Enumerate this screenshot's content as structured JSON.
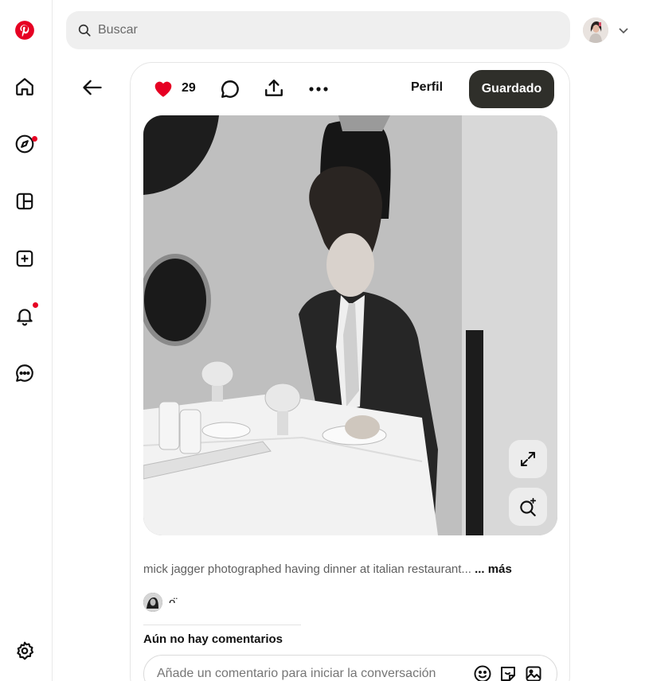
{
  "brand": {
    "logo_icon": "pinterest-logo-icon",
    "color": "#e60023"
  },
  "sidebar": {
    "items": [
      {
        "name": "home",
        "icon": "home-icon"
      },
      {
        "name": "explore",
        "icon": "compass-icon",
        "has_dot": true
      },
      {
        "name": "boards",
        "icon": "board-icon"
      },
      {
        "name": "create",
        "icon": "plus-square-icon"
      },
      {
        "name": "notifications",
        "icon": "bell-icon",
        "has_dot": true
      },
      {
        "name": "messages",
        "icon": "chat-icon"
      }
    ],
    "settings_icon": "gear-icon"
  },
  "header": {
    "search_placeholder": "Buscar"
  },
  "pin": {
    "likes": "29",
    "profile_label": "Perfil",
    "saved_label": "Guardado",
    "description": "mick jagger photographed having dinner at italian restaurant...",
    "more_label": "... más",
    "author_name": "ᴖ̈",
    "no_comments": "Aún no hay comentarios",
    "comment_placeholder": "Añade un comentario para iniciar la conversación"
  },
  "colors": {
    "accent": "#e60023",
    "saved_button": "#2f2f2a"
  }
}
